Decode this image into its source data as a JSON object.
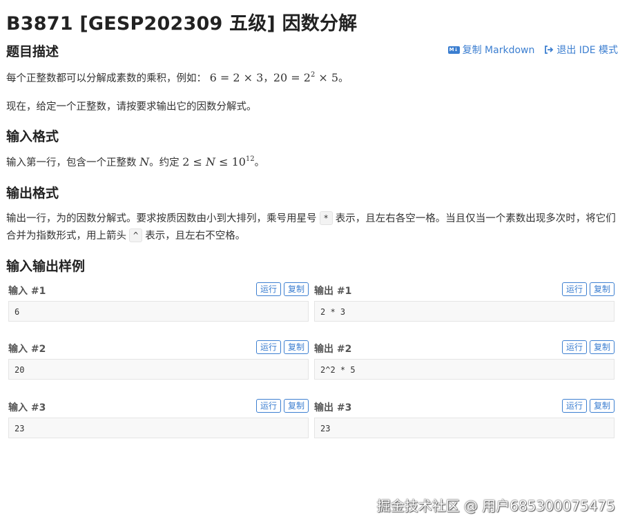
{
  "problem": {
    "title": "B3871 [GESP202309 五级] 因数分解"
  },
  "actions": {
    "copy_markdown": "复制 Markdown",
    "exit_ide": "退出 IDE 模式",
    "md_icon_text": "M↓"
  },
  "sections": {
    "description": {
      "heading": "题目描述",
      "p1_text": "每个正整数都可以分解成素数的乘积，例如：",
      "p1_math1": "6 = 2 × 3",
      "p1_sep": "，",
      "p1_math2_base": "20 = 2",
      "p1_math2_exp": "2",
      "p1_math2_tail": " × 5",
      "p1_end": "。",
      "p2": "现在，给定一个正整数，请按要求输出它的因数分解式。"
    },
    "input": {
      "heading": "输入格式",
      "text_a": "输入第一行，包含一个正整数 ",
      "var_n": "N",
      "text_b": "。约定 ",
      "range_a": "2 ≤ ",
      "range_b": " ≤ 10",
      "range_exp": "12",
      "text_c": "。"
    },
    "output": {
      "heading": "输出格式",
      "text_a": "输出一行，为的因数分解式。要求按质因数由小到大排列，乘号用星号",
      "star": "*",
      "text_b": "表示，且左右各空一格。当且仅当一个素数出现多次时，将它们合并为指数形式，用上箭头",
      "caret": "^",
      "text_c": "表示，且左右不空格。"
    },
    "samples": {
      "heading": "输入输出样例",
      "run_label": "运行",
      "copy_label": "复制",
      "items": [
        {
          "input_label": "输入 #1",
          "input": "6",
          "output_label": "输出 #1",
          "output": "2 * 3"
        },
        {
          "input_label": "输入 #2",
          "input": "20",
          "output_label": "输出 #2",
          "output": "2^2 * 5"
        },
        {
          "input_label": "输入 #3",
          "input": "23",
          "output_label": "输出 #3",
          "output": "23"
        }
      ]
    }
  },
  "watermark": "掘金技术社区 @ 用户685300075475"
}
